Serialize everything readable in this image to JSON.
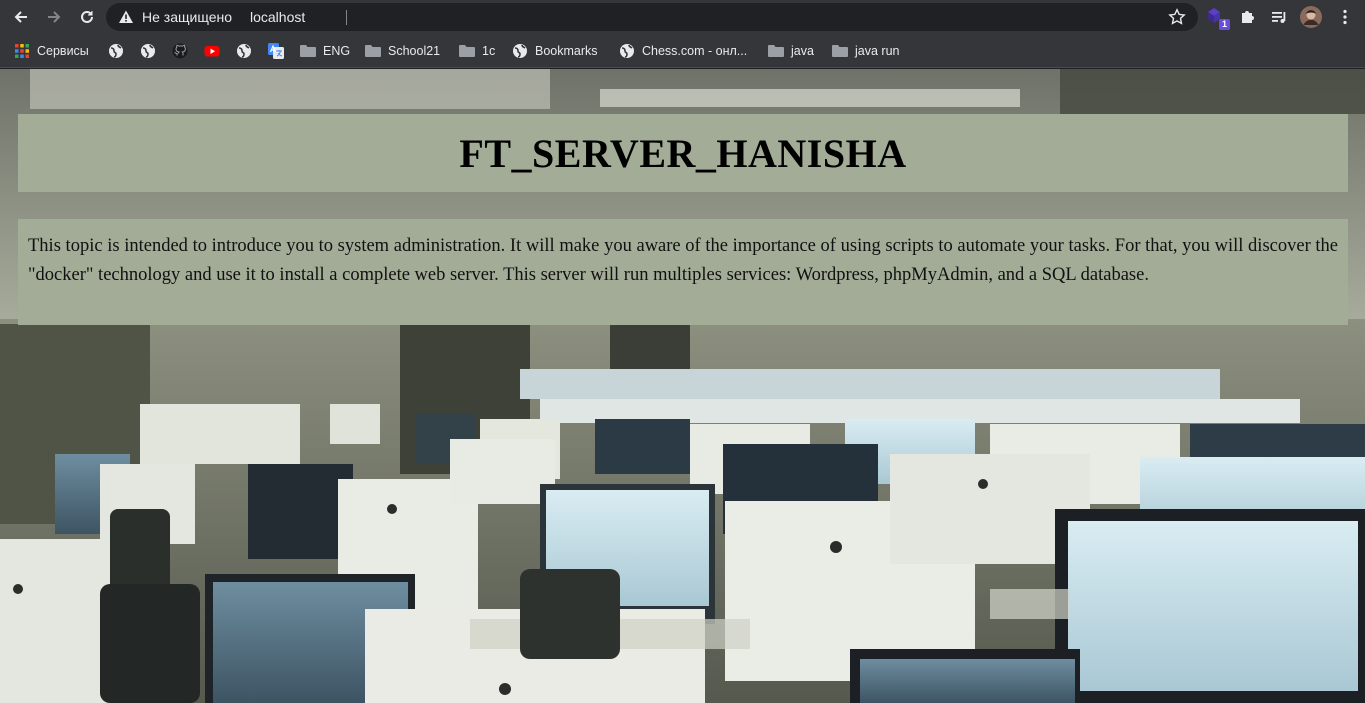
{
  "browser": {
    "security_label": "Не защищено",
    "url": "localhost",
    "extension_badge": "1"
  },
  "bookmarks": [
    {
      "label": "Сервисы",
      "icon": "apps-grid-icon"
    },
    {
      "label": "",
      "icon": "globe-icon"
    },
    {
      "label": "",
      "icon": "globe-icon"
    },
    {
      "label": "",
      "icon": "github-icon"
    },
    {
      "label": "",
      "icon": "youtube-icon"
    },
    {
      "label": "",
      "icon": "globe-icon"
    },
    {
      "label": "",
      "icon": "google-translate-icon"
    },
    {
      "label": "ENG",
      "icon": "folder-icon"
    },
    {
      "label": "School21",
      "icon": "folder-icon"
    },
    {
      "label": "1c",
      "icon": "folder-icon"
    },
    {
      "label": "Bookmarks",
      "icon": "globe-icon"
    },
    {
      "label": "Chess.com - онл...",
      "icon": "globe-icon"
    },
    {
      "label": "java",
      "icon": "folder-icon"
    },
    {
      "label": "java run",
      "icon": "folder-icon"
    }
  ],
  "page": {
    "title": "FT_SERVER_HANISHA",
    "intro": "This topic is intended to introduce you to system administration. It will make you aware of the importance of using scripts to automate your tasks. For that, you will discover the \"docker\" technology and use it to install a complete web server. This server will run multiples services: Wordpress, phpMyAdmin, and a SQL database."
  },
  "colors": {
    "chrome_bg": "#35363a",
    "omnibox_bg": "#202124",
    "panel_bg": "#a2ac97",
    "text": "#e8eaed"
  }
}
